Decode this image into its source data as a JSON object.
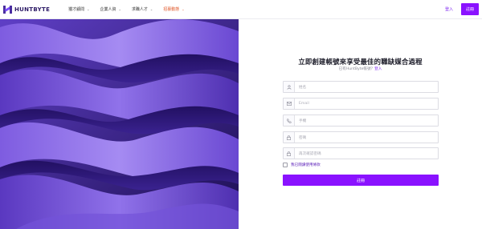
{
  "brand": {
    "name": "HUNTBYTE"
  },
  "nav": {
    "items": [
      {
        "label": "獵才顧問"
      },
      {
        "label": "企業人資"
      },
      {
        "label": "求職人才"
      },
      {
        "label": "招募動態"
      }
    ],
    "active_index": 3
  },
  "header_actions": {
    "login_label": "登入",
    "signup_label": "註冊"
  },
  "form": {
    "title": "立即創建帳號來享受最佳的職缺媒合過程",
    "subtitle_prefix": "已有HuntByte帳號？",
    "subtitle_link": "登入",
    "fields": [
      {
        "placeholder": "姓名",
        "icon": "user-icon"
      },
      {
        "placeholder": "Email",
        "icon": "mail-icon"
      },
      {
        "placeholder": "手機",
        "icon": "phone-icon"
      },
      {
        "placeholder": "密碼",
        "icon": "lock-icon"
      },
      {
        "placeholder": "再次確認密碼",
        "icon": "lock-icon"
      }
    ],
    "agree_label": "我已閱讀使用條款",
    "submit_label": "註冊"
  },
  "colors": {
    "accent": "#8a12ff",
    "active_nav": "#e0582a",
    "hero": "#5b3bc4"
  }
}
